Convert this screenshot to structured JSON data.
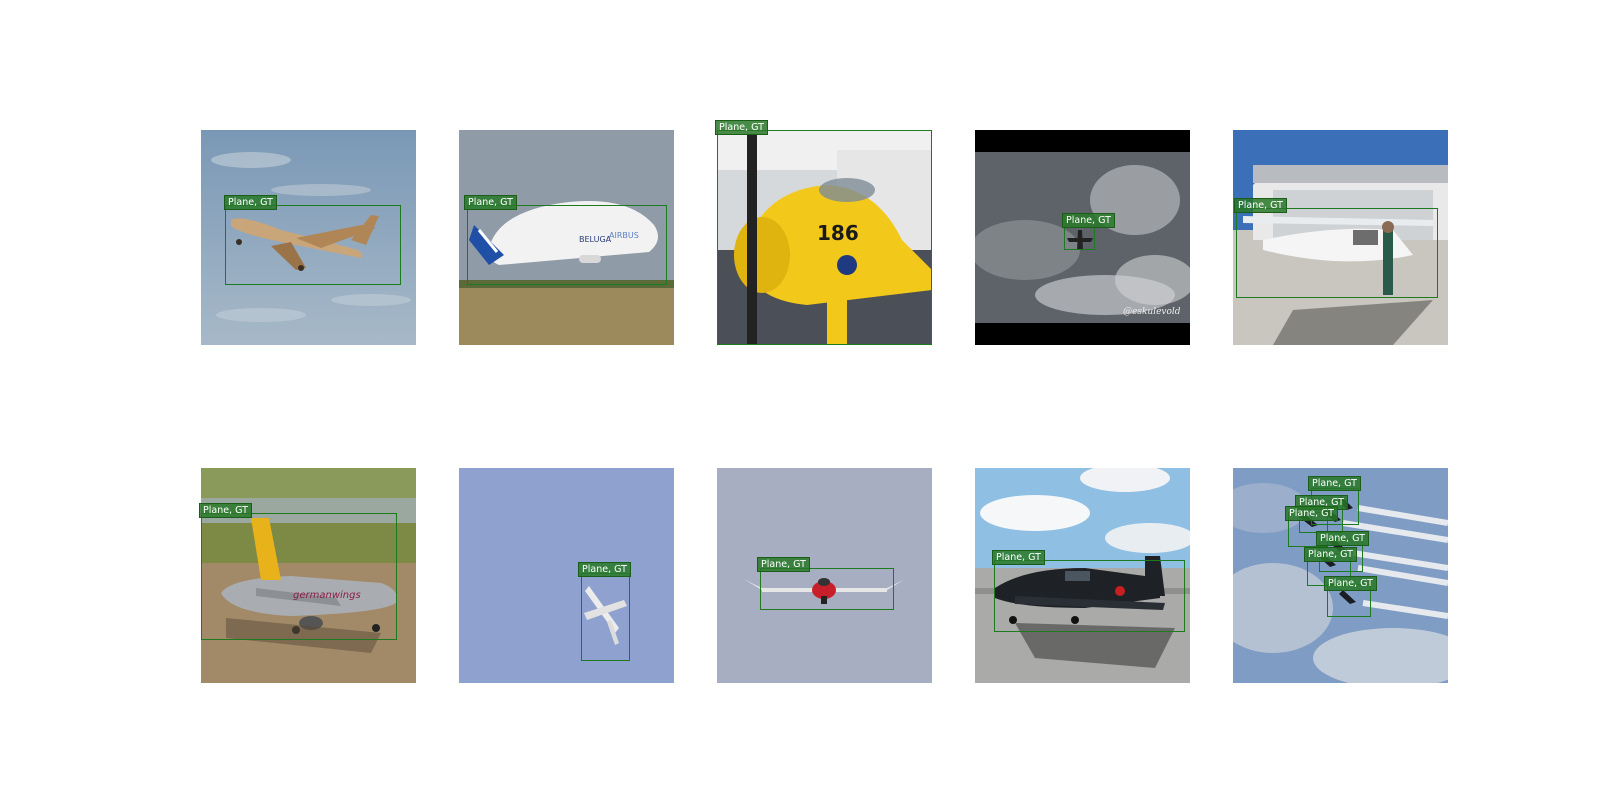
{
  "figure": {
    "panels": [
      {
        "id": "img-1",
        "boxes": [
          {
            "label": "Plane, GT"
          }
        ]
      },
      {
        "id": "img-2",
        "boxes": [
          {
            "label": "Plane, GT"
          }
        ]
      },
      {
        "id": "img-3",
        "boxes": [
          {
            "label": "Plane, GT"
          }
        ]
      },
      {
        "id": "img-4",
        "boxes": [
          {
            "label": "Plane, GT"
          }
        ],
        "watermark": "@eskulevold"
      },
      {
        "id": "img-5",
        "boxes": [
          {
            "label": "Plane, GT"
          }
        ]
      },
      {
        "id": "img-6",
        "boxes": [
          {
            "label": "Plane, GT"
          }
        ],
        "aircraft_text": "germanwings"
      },
      {
        "id": "img-7",
        "boxes": [
          {
            "label": "Plane, GT"
          }
        ]
      },
      {
        "id": "img-8",
        "boxes": [
          {
            "label": "Plane, GT"
          }
        ]
      },
      {
        "id": "img-9",
        "boxes": [
          {
            "label": "Plane, GT"
          }
        ]
      },
      {
        "id": "img-10",
        "boxes": [
          {
            "label": "Plane, GT"
          },
          {
            "label": "Plane, GT"
          },
          {
            "label": "Plane, GT"
          },
          {
            "label": "Plane, GT"
          },
          {
            "label": "Plane, GT"
          },
          {
            "label": "Plane, GT"
          }
        ]
      }
    ],
    "box_color": "#1e7a1e",
    "label_bg": "#2e8b2e"
  }
}
